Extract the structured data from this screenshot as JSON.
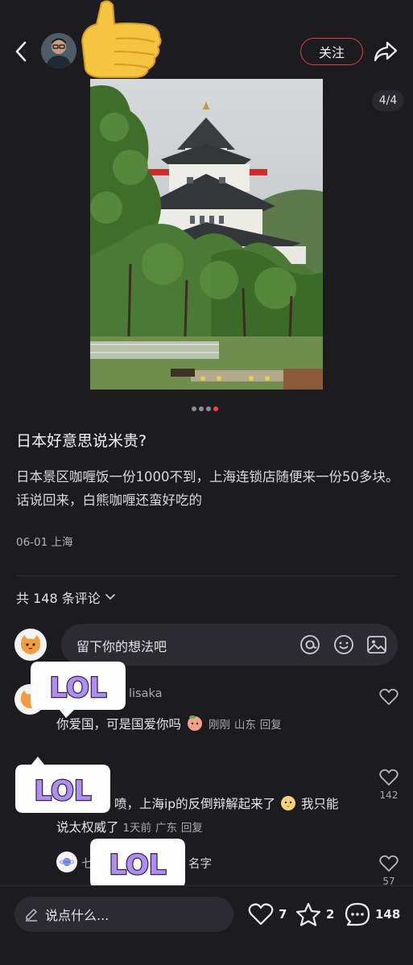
{
  "header": {
    "follow_label": "关注"
  },
  "photo": {
    "counter": "4/4",
    "total_dots": 4,
    "active_dot": 4
  },
  "post": {
    "title": "日本好意思说米贵?",
    "body": "日本景区咖喱饭一份1000不到，上海连锁店随便来一份50多块。话说回来，白熊咖喱还蛮好吃的",
    "meta": "06-01 上海"
  },
  "comments_header": {
    "label": "共 148 条评论"
  },
  "comment_input": {
    "placeholder": "留下你的想法吧"
  },
  "comments": [
    {
      "name_fragment": "lisaka",
      "text": "你爱国，可是国爱你吗",
      "time": "刚刚",
      "location": "山东",
      "reply": "回复",
      "likes": ""
    },
    {
      "text_line1": "喷，上海ip的反倒辩解起来了",
      "text_line1_tail": "我只能",
      "text_line2": "说太权威了",
      "time": "1天前",
      "location": "广东",
      "reply": "回复",
      "likes": "142"
    },
    {
      "name_prefix": "七",
      "name_fragment": "名字",
      "likes": "57"
    }
  ],
  "stickers": {
    "lol_text": "LOL"
  },
  "bottom_bar": {
    "say_placeholder": "说点什么...",
    "likes": "7",
    "stars": "2",
    "comments": "148"
  },
  "colors": {
    "background": "#1c1b20",
    "accent_red": "#ff3a47",
    "follow_border": "#e0403f",
    "input_bg": "#2c2b31"
  }
}
